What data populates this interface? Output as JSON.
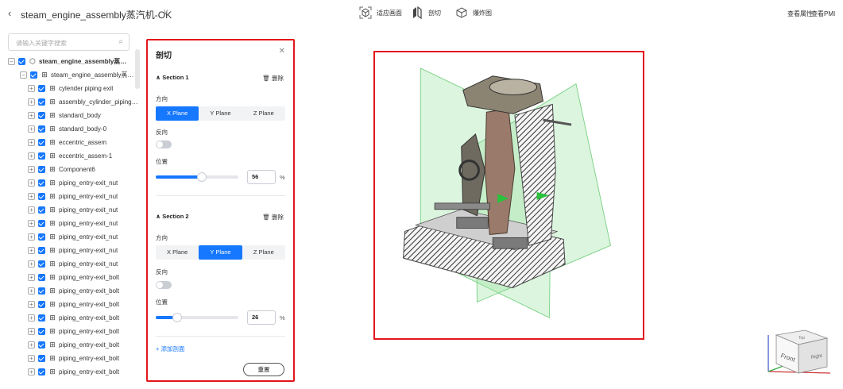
{
  "header": {
    "back_icon": "chevron-left-icon",
    "title": "steam_engine_assembly蒸汽机-OK",
    "tools": [
      {
        "label": "适应画面",
        "icon": "fit-view-icon"
      },
      {
        "label": "剖切",
        "icon": "section-cut-icon"
      },
      {
        "label": "爆炸图",
        "icon": "explode-view-icon"
      }
    ],
    "view_properties": "查看属性",
    "view_pmi": "查看PMI"
  },
  "tree": {
    "search_placeholder": "请输入关键字搜索",
    "root": "steam_engine_assembly蒸汽机",
    "sub_root": "steam_engine_assembly蒸汽机",
    "items": [
      "cylender piping exit",
      "assembly_cylinder_piping_e",
      "standard_body",
      "standard_body-0",
      "eccentric_assem",
      "eccentric_assem-1",
      "Component6",
      "piping_entry-exit_nut",
      "piping_entry-exit_nut",
      "piping_entry-exit_nut",
      "piping_entry-exit_nut",
      "piping_entry-exit_nut",
      "piping_entry-exit_nut",
      "piping_entry-exit_nut",
      "piping_entry-exit_bolt",
      "piping_entry-exit_bolt",
      "piping_entry-exit_bolt",
      "piping_entry-exit_bolt",
      "piping_entry-exit_bolt",
      "piping_entry-exit_bolt",
      "piping_entry-exit_bolt",
      "piping_entry-exit_bolt"
    ]
  },
  "section_panel": {
    "title": "剖切",
    "close_icon": "close-icon",
    "sections": [
      {
        "name": "Section 1",
        "delete_label": "删除",
        "direction_label": "方向",
        "planes": [
          "X Plane",
          "Y Plane",
          "Z Plane"
        ],
        "active_plane": "X Plane",
        "reverse_label": "反向",
        "reverse": false,
        "position_label": "位置",
        "position": "56",
        "position_fraction": 0.56,
        "unit": "%"
      },
      {
        "name": "Section 2",
        "delete_label": "删除",
        "direction_label": "方向",
        "planes": [
          "X Plane",
          "Y Plane",
          "Z Plane"
        ],
        "active_plane": "Y Plane",
        "reverse_label": "反向",
        "reverse": false,
        "position_label": "位置",
        "position": "26",
        "position_fraction": 0.26,
        "unit": "%"
      }
    ],
    "add_section": "+ 添加剖面",
    "reset": "重置"
  },
  "view_cube": {
    "front": "Front",
    "right": "Right",
    "top": "Top"
  },
  "colors": {
    "accent": "#1677ff",
    "highlight_border": "#e3161c",
    "section_plane": "#9be3a0"
  }
}
